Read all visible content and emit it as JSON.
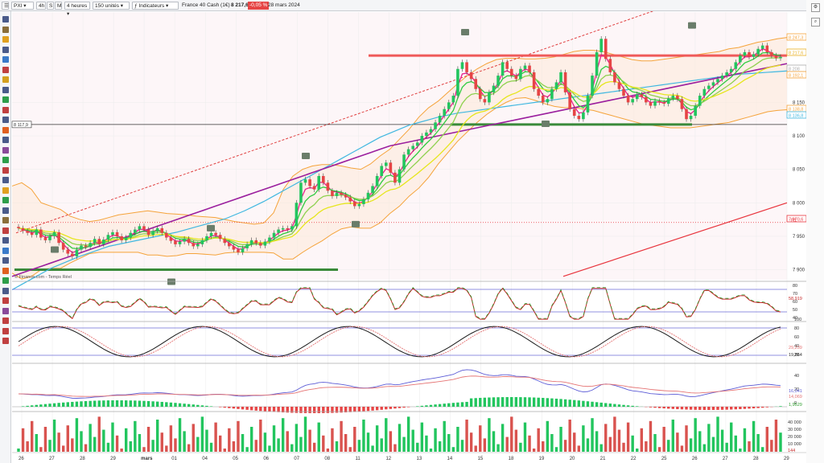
{
  "toolbar": {
    "symbol": "PXI",
    "period": "4h",
    "btn_s": "S",
    "btn_m": "M",
    "interval": "4 heures",
    "units": "150 unités",
    "indicators": "Indicateurs",
    "instrument": "France 40 Cash (1€)",
    "price": "8 217,6",
    "change": "-0,05 %",
    "date": "28 mars 2024"
  },
  "watermark": "© Finance.com - Temps Réel",
  "colors": {
    "up": "#22c55e",
    "down": "#e64545",
    "bollinger": "#f5a33a",
    "sma_blue": "#3fb7e0",
    "sma_purple": "#9b1f9e",
    "red_line": "#e8333c",
    "dashed": "#e04040",
    "support": "#3a8a3a",
    "resistance": "#ef5a5a",
    "panel_line_blue": "#6b6bd6",
    "volume_up": "#22c55e",
    "volume_down": "#d9534f"
  },
  "price_axis": {
    "labels": [
      "8 150",
      "8 100",
      "8 050",
      "8 000",
      "7 950",
      "7 900"
    ],
    "badges": [
      {
        "text": "8 247,3",
        "color": "#f5a33a"
      },
      {
        "text": "8 217,6",
        "color": "#e8b020"
      },
      {
        "text": "8 208",
        "color": "#aaaaaa"
      },
      {
        "text": "8 192,1",
        "color": "#f5a33a"
      },
      {
        "text": "8 138,8",
        "color": "#f5a33a"
      },
      {
        "text": "8 136,8",
        "color": "#3fb7e0"
      },
      {
        "text": "7 970,6",
        "color": "#e8333c"
      }
    ],
    "level_left": "8 117,9",
    "r1_label": "R1",
    "y_range": [
      7885,
      8285
    ]
  },
  "chart_data": {
    "type": "candlestick",
    "title": "France 40 Cash (1€)",
    "x_ticks": [
      "26",
      "27",
      "28",
      "29",
      "mars",
      "01",
      "04",
      "05",
      "06",
      "07",
      "08",
      "11",
      "12",
      "13",
      "14",
      "15",
      "18",
      "19",
      "20",
      "21",
      "22",
      "25",
      "26",
      "27",
      "28",
      "29"
    ],
    "closes": [
      7962,
      7958,
      7955,
      7952,
      7960,
      7948,
      7944,
      7950,
      7956,
      7940,
      7930,
      7924,
      7920,
      7930,
      7936,
      7934,
      7940,
      7946,
      7938,
      7945,
      7952,
      7956,
      7950,
      7944,
      7948,
      7955,
      7960,
      7965,
      7960,
      7952,
      7958,
      7962,
      7955,
      7948,
      7943,
      7938,
      7942,
      7946,
      7940,
      7935,
      7938,
      7944,
      7950,
      7955,
      7952,
      7946,
      7940,
      7935,
      7930,
      7926,
      7932,
      7938,
      7944,
      7940,
      7936,
      7942,
      7948,
      7955,
      7960,
      7962,
      7960,
      7965,
      8000,
      8030,
      8035,
      8025,
      8020,
      8040,
      8030,
      8018,
      8010,
      8015,
      8012,
      8008,
      8002,
      7995,
      7998,
      8005,
      8015,
      8025,
      8040,
      8055,
      8060,
      8045,
      8030,
      8050,
      8072,
      8080,
      8085,
      8090,
      8100,
      8105,
      8110,
      8120,
      8130,
      8140,
      8150,
      8160,
      8200,
      8210,
      8195,
      8185,
      8170,
      8155,
      8150,
      8165,
      8175,
      8190,
      8210,
      8200,
      8190,
      8185,
      8200,
      8205,
      8195,
      8170,
      8160,
      8150,
      8155,
      8170,
      8180,
      8195,
      8165,
      8140,
      8130,
      8125,
      8135,
      8160,
      8190,
      8225,
      8245,
      8215,
      8195,
      8180,
      8170,
      8160,
      8150,
      8155,
      8162,
      8158,
      8150,
      8145,
      8152,
      8150,
      8148,
      8156,
      8160,
      8155,
      8140,
      8125,
      8130,
      8145,
      8160,
      8170,
      8175,
      8180,
      8185,
      8190,
      8195,
      8200,
      8210,
      8220,
      8225,
      8218,
      8222,
      8230,
      8235,
      8225,
      8220,
      8216,
      8218
    ],
    "bb_upper": [
      8025,
      8030,
      8020,
      8000,
      7995,
      7990,
      7980,
      7975,
      7972,
      7974,
      7978,
      7982,
      7984,
      7986,
      7988,
      7986,
      7984,
      7983,
      7982,
      7980,
      7979,
      7978,
      7975,
      7972,
      7970,
      7968,
      7970,
      7985,
      8020,
      8040,
      8050,
      8055,
      8057,
      8057,
      8055,
      8052,
      8050,
      8058,
      8070,
      8080,
      8095,
      8110,
      8128,
      8142,
      8152,
      8165,
      8178,
      8190,
      8200,
      8208,
      8214,
      8216,
      8216,
      8215,
      8215,
      8216,
      8218,
      8222,
      8226,
      8228,
      8228,
      8226,
      8222,
      8218,
      8214,
      8212,
      8212,
      8214,
      8216,
      8218,
      8220,
      8222,
      8224,
      8226,
      8230,
      8232,
      8236,
      8240,
      8242,
      8245,
      8247
    ],
    "bb_middle": [
      7960,
      7958,
      7955,
      7950,
      7948,
      7946,
      7945,
      7946,
      7948,
      7950,
      7952,
      7954,
      7955,
      7956,
      7955,
      7954,
      7952,
      7952,
      7953,
      7952,
      7951,
      7950,
      7950,
      7949,
      7948,
      7947,
      7948,
      7955,
      7968,
      7978,
      7988,
      7995,
      8000,
      8005,
      8008,
      8008,
      8006,
      8010,
      8020,
      8032,
      8045,
      8060,
      8075,
      8090,
      8105,
      8120,
      8135,
      8148,
      8160,
      8170,
      8178,
      8183,
      8186,
      8186,
      8184,
      8182,
      8181,
      8182,
      8184,
      8184,
      8183,
      8180,
      8176,
      8172,
      8168,
      8165,
      8164,
      8164,
      8164,
      8165,
      8166,
      8168,
      8170,
      8172,
      8175,
      8178,
      8182,
      8186,
      8190,
      8193,
      8195
    ],
    "bb_lower": [
      7895,
      7886,
      7890,
      7900,
      7902,
      7902,
      7910,
      7917,
      7924,
      7926,
      7926,
      7926,
      7926,
      7926,
      7922,
      7922,
      7920,
      7921,
      7924,
      7924,
      7923,
      7922,
      7925,
      7926,
      7926,
      7926,
      7926,
      7925,
      7916,
      7916,
      7926,
      7935,
      7943,
      7953,
      7961,
      7964,
      7962,
      7962,
      7970,
      7984,
      7995,
      8010,
      8022,
      8038,
      8058,
      8075,
      8092,
      8106,
      8120,
      8132,
      8142,
      8150,
      8156,
      8157,
      8153,
      8148,
      8144,
      8142,
      8142,
      8140,
      8138,
      8134,
      8130,
      8126,
      8122,
      8118,
      8116,
      8114,
      8112,
      8112,
      8112,
      8114,
      8116,
      8118,
      8120,
      8124,
      8128,
      8132,
      8136,
      8138,
      8139
    ],
    "sma_blue": [
      7870,
      7878,
      7886,
      7894,
      7902,
      7908,
      7914,
      7920,
      7925,
      7930,
      7935,
      7938,
      7941,
      7944,
      7947,
      7950,
      7953,
      7956,
      7960,
      7964,
      7968,
      7972,
      7976,
      7982,
      7988,
      7995,
      8002,
      8010,
      8018,
      8026,
      8034,
      8042,
      8050,
      8058,
      8066,
      8074,
      8082,
      8090,
      8098,
      8104,
      8110,
      8116,
      8120,
      8124,
      8128,
      8131,
      8134,
      8136,
      8138,
      8140,
      8142,
      8144,
      8146,
      8148,
      8150,
      8152,
      8154,
      8156,
      8158,
      8160,
      8162,
      8164,
      8166,
      8168,
      8170,
      8172,
      8174,
      8176,
      8178,
      8180,
      8182,
      8184,
      8186,
      8188,
      8190,
      8192,
      8193,
      8194,
      8195,
      8196,
      8197
    ],
    "sma_purple": [
      7890,
      7895,
      7900,
      7905,
      7910,
      7915,
      7920,
      7925,
      7930,
      7935,
      7940,
      7945,
      7950,
      7955,
      7960,
      7965,
      7970,
      7975,
      7980,
      7985,
      7990,
      7995,
      8000,
      8005,
      8010,
      8015,
      8020,
      8025,
      8030,
      8035,
      8040,
      8045,
      8050,
      8055,
      8060,
      8065,
      8070,
      8075,
      8080,
      8085,
      8088,
      8091,
      8094,
      8097,
      8100,
      8103,
      8106,
      8109,
      8112,
      8115,
      8118,
      8121,
      8124,
      8127,
      8130,
      8133,
      8136,
      8139,
      8142,
      8145,
      8148,
      8151,
      8154,
      8157,
      8160,
      8163,
      8166,
      8169,
      8172,
      8175,
      8178,
      8181,
      8184,
      8187,
      8190,
      8193,
      8196,
      8199,
      8202,
      8205,
      8208
    ],
    "red_trend": [
      7890,
      8000
    ],
    "dashed_trend": [
      7955,
      8290
    ],
    "support_1": 7900,
    "support_2": 8117,
    "resistance": 8220,
    "r1_level": 7970.6
  },
  "rsi_panel": {
    "labels": [
      "80",
      "70",
      "60",
      "50",
      "40"
    ],
    "value": "58,919"
  },
  "stoch_panel": {
    "labels": [
      "100",
      "80",
      "60",
      "40",
      "20"
    ],
    "values": [
      "29,239",
      "19,864"
    ]
  },
  "macd_panel": {
    "labels": [
      "40",
      "20",
      "0"
    ],
    "values": [
      "16,041",
      "14,069",
      "1,9529"
    ]
  },
  "volume_panel": {
    "labels": [
      "40 000",
      "30 000",
      "20 000",
      "10 000"
    ],
    "value": "144"
  }
}
